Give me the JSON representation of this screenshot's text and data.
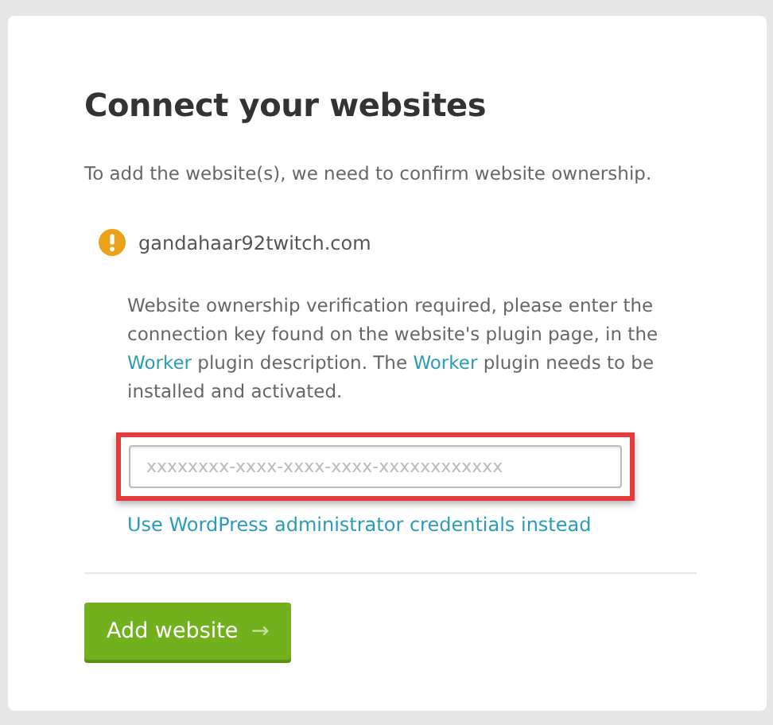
{
  "title": "Connect your websites",
  "intro": "To add the website(s), we need to confirm website ownership.",
  "site": {
    "domain": "gandahaar92twitch.com",
    "verified": false
  },
  "notice": [
    {
      "kind": "text",
      "text": "Website ownership verification required, please enter the connection key found on the website's plugin page, in the "
    },
    {
      "kind": "link",
      "text": "Worker"
    },
    {
      "kind": "text",
      "text": " plugin description. The "
    },
    {
      "kind": "link",
      "text": "Worker"
    },
    {
      "kind": "text",
      "text": " plugin needs to be installed and activated."
    }
  ],
  "key_field": {
    "placeholder": "xxxxxxxx-xxxx-xxxx-xxxx-xxxxxxxxxxxx",
    "highlighted": true
  },
  "alt_link": "Use WordPress administrator credentials instead",
  "button": {
    "label": "Add website",
    "arrow": "→"
  }
}
